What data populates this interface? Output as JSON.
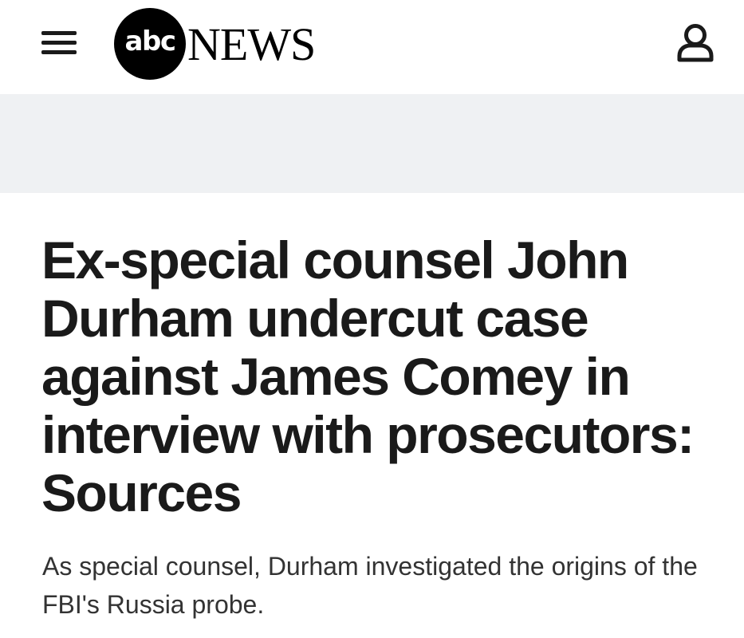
{
  "header": {
    "menu_icon": "hamburger-menu-icon",
    "logo": {
      "abc_text": "abc",
      "news_text": "NEWS"
    },
    "account_icon": "user-account-icon"
  },
  "article": {
    "headline": "Ex-special counsel John Durham undercut case against James Comey in interview with prosecutors: Sources",
    "dek": "As special counsel, Durham investigated the origins of the FBI's Russia probe."
  },
  "colors": {
    "text": "#1a1a1a",
    "banner_bg": "#eff1f3",
    "logo": "#000000"
  }
}
